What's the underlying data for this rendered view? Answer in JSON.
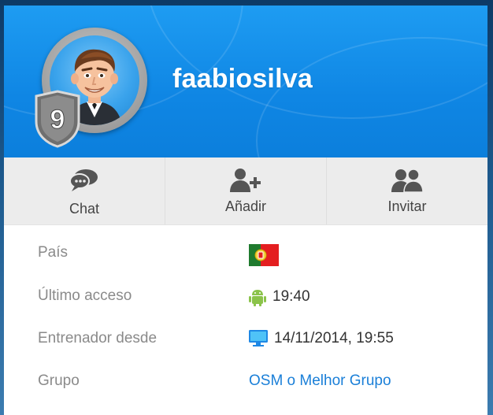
{
  "profile": {
    "username": "faabiosilva",
    "level": "9"
  },
  "actions": [
    {
      "label": "Chat",
      "icon": "chat-icon"
    },
    {
      "label": "Añadir",
      "icon": "add-user-icon"
    },
    {
      "label": "Invitar",
      "icon": "invite-icon"
    }
  ],
  "info": {
    "country_label": "País",
    "country_value_icon": "portugal-flag-icon",
    "last_access_label": "Último acceso",
    "last_access_value": "19:40",
    "last_access_icon": "android-icon",
    "trainer_since_label": "Entrenador desde",
    "trainer_since_value": "14/11/2014, 19:55",
    "trainer_since_icon": "desktop-icon",
    "group_label": "Grupo",
    "group_value": "OSM o Melhor Grupo"
  },
  "colors": {
    "header_blue": "#0f86e4",
    "link_blue": "#1a7fd8",
    "label_gray": "#8a8a8a"
  }
}
